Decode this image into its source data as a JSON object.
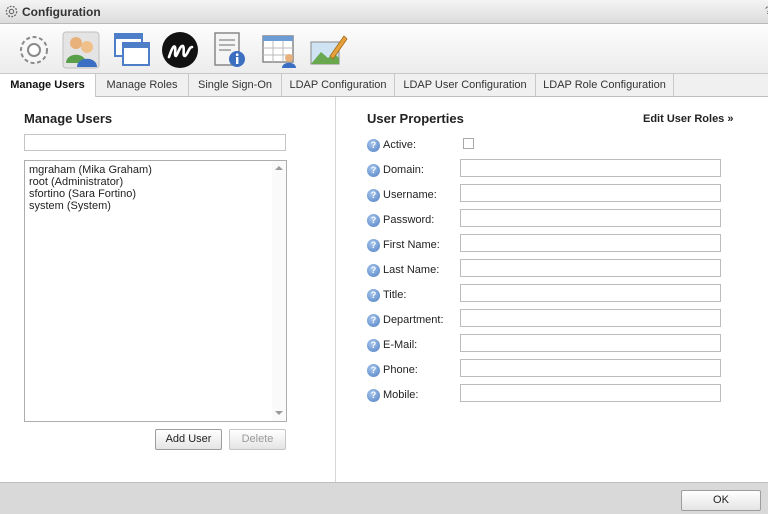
{
  "window": {
    "title": "Configuration",
    "help_glyph": "?"
  },
  "toolbar": {
    "icons": [
      "gear-icon",
      "users-icon",
      "windows-icon",
      "m-logo-icon",
      "document-info-icon",
      "calendar-user-icon",
      "image-pen-icon"
    ]
  },
  "tabs": [
    {
      "label": "Manage Users",
      "active": true
    },
    {
      "label": "Manage Roles",
      "active": false
    },
    {
      "label": "Single Sign-On",
      "active": false
    },
    {
      "label": "LDAP Configuration",
      "active": false
    },
    {
      "label": "LDAP User Configuration",
      "active": false
    },
    {
      "label": "LDAP Role Configuration",
      "active": false
    }
  ],
  "manage_users": {
    "title": "Manage Users",
    "filter_value": "",
    "users": [
      "mgraham (Mika Graham)",
      "root (Administrator)",
      "sfortino (Sara Fortino)",
      "system (System)"
    ],
    "add_label": "Add User",
    "delete_label": "Delete"
  },
  "user_properties": {
    "title": "User Properties",
    "edit_roles_label": "Edit User Roles »",
    "active_label": "Active:",
    "fields": [
      "Domain:",
      "Username:",
      "Password:",
      "First Name:",
      "Last Name:",
      "Title:",
      "Department:",
      "E-Mail:",
      "Phone:",
      "Mobile:"
    ]
  },
  "footer": {
    "ok_label": "OK"
  },
  "colors": {
    "help_icon": "#4f7fc4",
    "footer": "#d9d9d9"
  }
}
